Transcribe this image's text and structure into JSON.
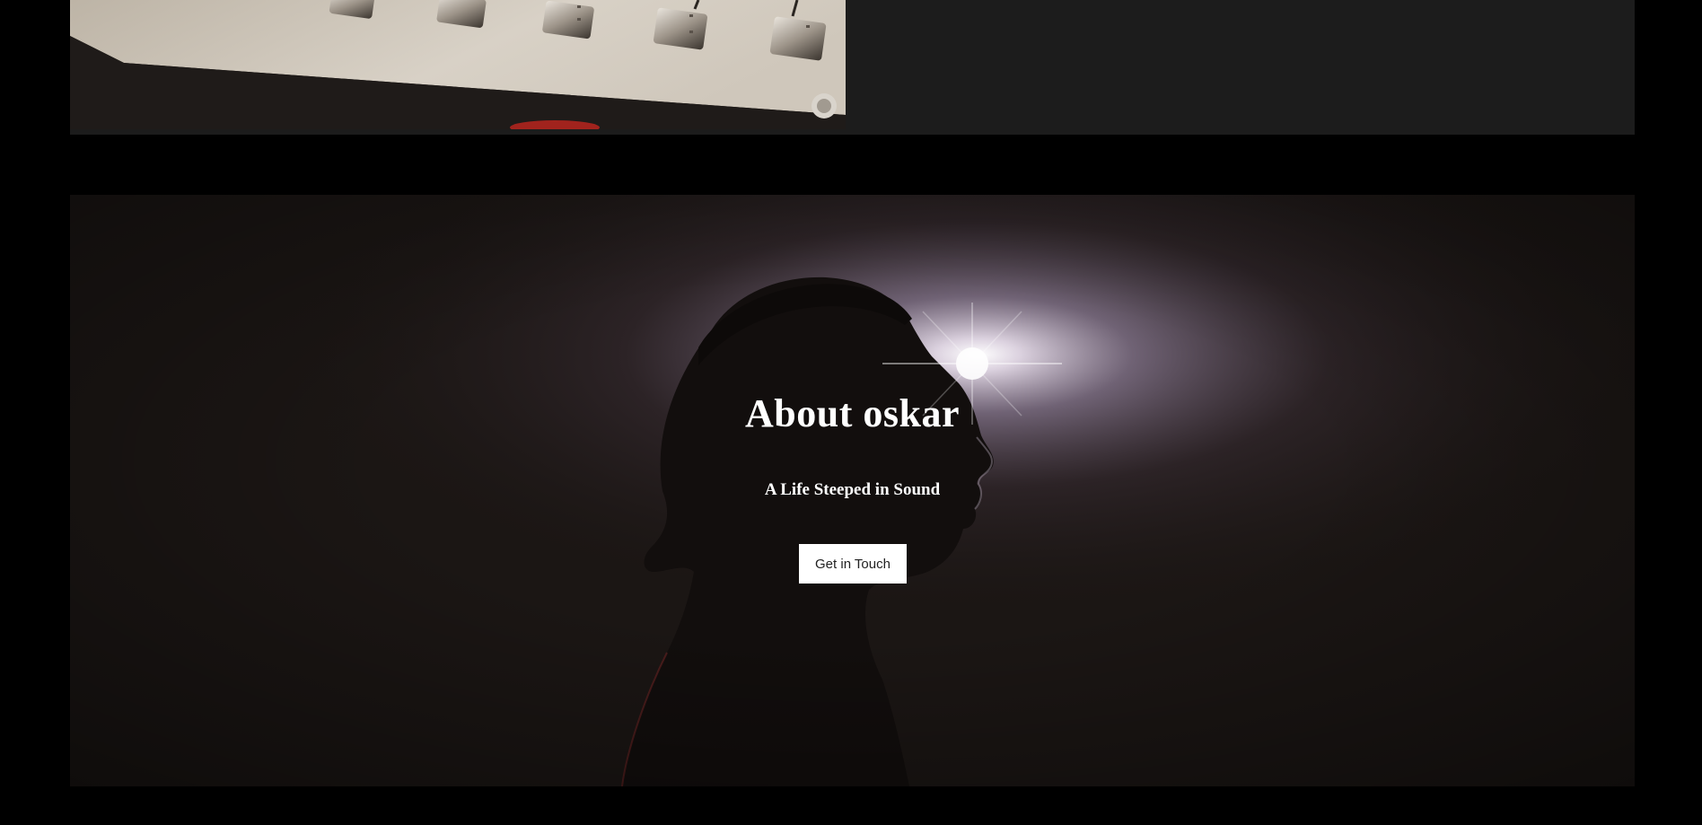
{
  "gallery": {
    "image_alt": "mixing-console-faders"
  },
  "about": {
    "title": "About oskar",
    "subtitle": "A Life Steeped in Sound",
    "cta_label": "Get in Touch",
    "background_image": "silhouette-profile-backlit"
  },
  "colors": {
    "page_background": "#000000",
    "card_background": "#1c1c1c",
    "hero_text": "#ffffff",
    "button_background": "#ffffff",
    "button_text": "#222222"
  }
}
